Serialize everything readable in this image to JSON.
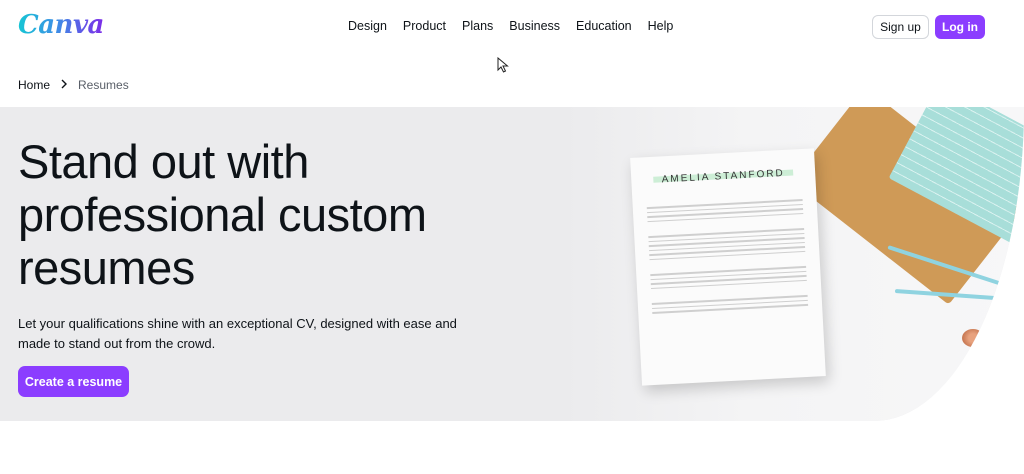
{
  "header": {
    "logo": "Canva",
    "nav": [
      "Design",
      "Product",
      "Plans",
      "Business",
      "Education",
      "Help"
    ],
    "signup_label": "Sign up",
    "login_label": "Log in"
  },
  "breadcrumb": {
    "home": "Home",
    "separator": "›",
    "current": "Resumes"
  },
  "hero": {
    "title": "Stand out with professional custom resumes",
    "description": "Let your qualifications shine with an exceptional CV, designed with ease and made to stand out from the crowd.",
    "cta_label": "Create a resume",
    "resume_name": "AMELIA STANFORD"
  },
  "colors": {
    "accent": "#8b3dff",
    "hero_bg": "#ebebed"
  },
  "icons": [
    "chevron-right-icon",
    "mouse-pointer-icon"
  ]
}
